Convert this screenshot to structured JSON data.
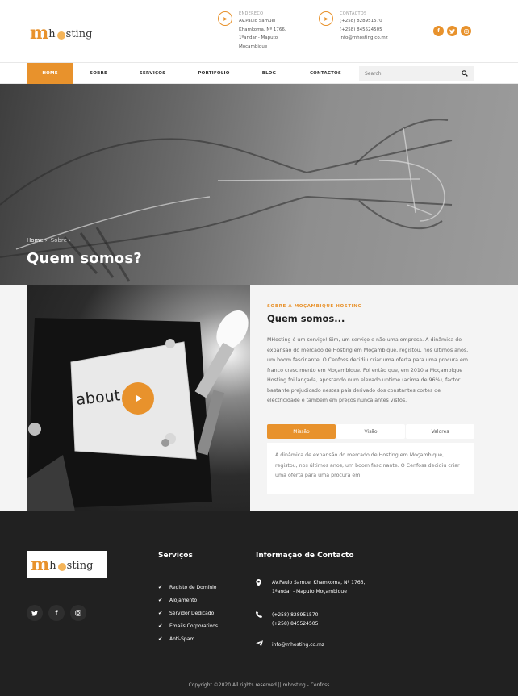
{
  "brand": {
    "logo_m": "m",
    "logo_rest": "sting",
    "logo_h": "h",
    "accent": "#e8922c"
  },
  "header": {
    "address": {
      "label": "ENDEREÇO",
      "lines": [
        "AV.Paulo Samuel",
        "Khamkoma, Nº 1766,",
        "1ºandar - Maputo",
        "Moçambique"
      ]
    },
    "contacts": {
      "label": "CONTACTOS",
      "lines": [
        "(+258) 828951570",
        "(+258) 845524505",
        "info@mhosting.co.mz"
      ]
    }
  },
  "nav": {
    "items": [
      "HOME",
      "SOBRE",
      "SERVIÇOS",
      "PORTIFOLIO",
      "BLOG",
      "CONTACTOS"
    ],
    "search_placeholder": "Search"
  },
  "hero": {
    "breadcrumb": [
      {
        "label": "Home",
        "sep": "›"
      },
      {
        "label": "Sobre",
        "sep": "›"
      }
    ],
    "title": "Quem somos?"
  },
  "about": {
    "image_text": "about",
    "eyebrow": "SOBRE A MOÇAMBIQUE HOSTING",
    "title": "Quem somos...",
    "body": "MHosting é um serviço! Sim, um serviço e não uma empresa. A dinâmica de expansão do mercado de Hosting em Moçambique, registou, nos últimos anos, um boom fascinante. O Cenfoss decidiu criar uma oferta para uma procura em franco crescimento em Moçambique. Foi então que, em 2010 a Moçambique Hosting foi lançada, apostando num elevado uptime (acima de 96%), factor bastante prejudicado nestes pais derivado dos constantes cortes de electricidade e também em preços nunca antes vistos.",
    "tabs": [
      "Missão",
      "Visão",
      "Valores"
    ],
    "tab_content": "A dinâmica de expansão do mercado de Hosting em Moçambique, registou, nos últimos anos, um boom fascinante. O Cenfoss decidiu criar uma oferta para uma procura em"
  },
  "footer": {
    "services_title": "Serviços",
    "services": [
      "Registo de Domínio",
      "Alojamento",
      "Servidor Dedicado",
      "Emails Corporativos",
      "Anti-Spam"
    ],
    "contact_title": "Informação de Contacto",
    "address": "AV.Paulo Samuel Khamkoma, Nº 1766, 1ºandar - Maputo Moçambique",
    "phone1": "(+258) 828951570",
    "phone2": "(+258) 845524505",
    "email": "info@mhosting.co.mz",
    "copyright": "Copyright ©2020 All rights reserved || mhosting - Cenfoss"
  },
  "icons": {
    "top_social": [
      "facebook-icon",
      "twitter-icon",
      "instagram-icon"
    ],
    "footer_social": [
      "twitter-icon",
      "facebook-icon",
      "instagram-icon"
    ]
  }
}
